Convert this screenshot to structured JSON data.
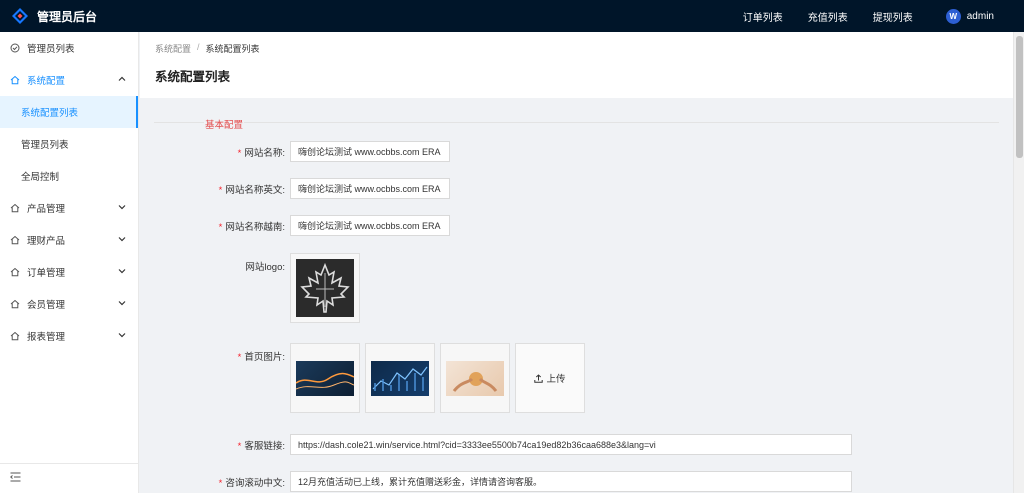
{
  "app": {
    "title": "管理员后台",
    "logo_icon": "diamond-logo-icon"
  },
  "topnav": {
    "items": [
      {
        "label": "订单列表"
      },
      {
        "label": "充值列表"
      },
      {
        "label": "提现列表"
      }
    ],
    "user": {
      "name": "admin",
      "avatar_text": "W"
    }
  },
  "sidebar": {
    "items": [
      {
        "label": "管理员列表",
        "icon": "circle-check-icon"
      },
      {
        "label": "系统配置",
        "icon": "home-icon",
        "open": true,
        "children": [
          {
            "label": "系统配置列表",
            "active": true
          },
          {
            "label": "管理员列表"
          },
          {
            "label": "全局控制"
          }
        ]
      },
      {
        "label": "产品管理",
        "icon": "home-icon"
      },
      {
        "label": "理财产品",
        "icon": "home-icon"
      },
      {
        "label": "订单管理",
        "icon": "home-icon"
      },
      {
        "label": "会员管理",
        "icon": "home-icon"
      },
      {
        "label": "报表管理",
        "icon": "home-icon"
      }
    ],
    "collapse_icon": "menu-fold-icon"
  },
  "breadcrumb": {
    "parent": "系统配置",
    "separator": "/",
    "current": "系统配置列表"
  },
  "page": {
    "title": "系统配置列表"
  },
  "form": {
    "section_title": "基本配置",
    "site_name": {
      "label": "网站名称:",
      "value": "嗨创论坛测试 www.ocbbs.com ERA",
      "required": true
    },
    "site_name_en": {
      "label": "网站名称英文:",
      "value": "嗨创论坛测试 www.ocbbs.com ERA",
      "required": true
    },
    "site_name_vi": {
      "label": "网站名称越南:",
      "value": "嗨创论坛测试 www.ocbbs.com ERA",
      "required": true
    },
    "site_logo": {
      "label": "网站logo:",
      "required": false
    },
    "home_images": {
      "label": "首页图片:",
      "required": true,
      "upload_label": "上传",
      "upload_icon": "upload-icon"
    },
    "service_link": {
      "label": "客服链接:",
      "value": "https://dash.cole21.win/service.html?cid=3333ee5500b74ca19ed82b36caa688e3&lang=vi",
      "required": true
    },
    "marquee_cn": {
      "label": "咨询滚动中文:",
      "value": "12月充值活动已上线，累计充值赠送彩金，详情请咨询客服。",
      "required": true
    }
  },
  "colors": {
    "header_bg": "#001529",
    "accent": "#1890ff",
    "required": "#f5222d",
    "section_title": "#e34b4b"
  }
}
